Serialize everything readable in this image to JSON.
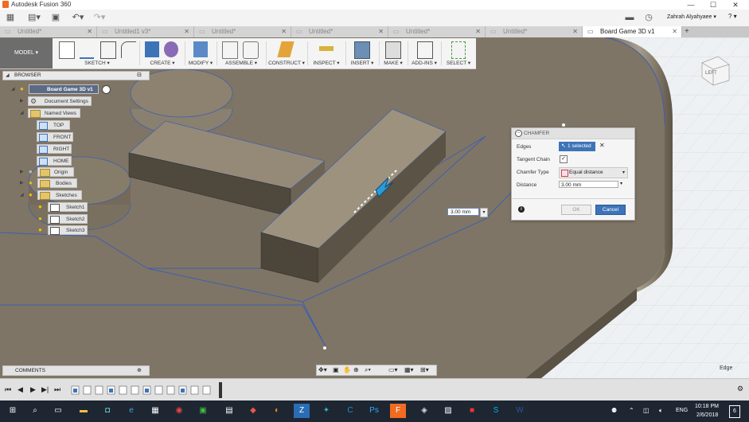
{
  "window": {
    "title": "Autodesk Fusion 360",
    "minimize": "—",
    "maximize": "☐",
    "close": "✕"
  },
  "appbar": {
    "user": "Zahrah Alyahyaee ▾",
    "help": "? ▾",
    "icons": [
      "apps-grid-icon",
      "file-icon",
      "save-icon",
      "undo-icon",
      "redo-icon",
      "chat-icon",
      "clock-icon"
    ]
  },
  "tabs": [
    {
      "label": "Untitled*",
      "active": false
    },
    {
      "label": "Untitled1 v3*",
      "active": false
    },
    {
      "label": "Untitled*",
      "active": false
    },
    {
      "label": "Untitled*",
      "active": false
    },
    {
      "label": "Untitled*",
      "active": false
    },
    {
      "label": "Untitled*",
      "active": false
    },
    {
      "label": "Board Game 3D v1",
      "active": true
    }
  ],
  "toolbar": {
    "mode": "MODEL ▾",
    "groups": [
      "SKETCH ▾",
      "CREATE ▾",
      "MODIFY ▾",
      "ASSEMBLE ▾",
      "CONSTRUCT ▾",
      "INSPECT ▾",
      "INSERT ▾",
      "MAKE ▾",
      "ADD-INS ▾",
      "SELECT ▾"
    ]
  },
  "browser": {
    "title": "BROWSER",
    "root": "Board Game 3D v1",
    "document_settings": "Document Settings",
    "named_views": "Named Views",
    "views": [
      "TOP",
      "FRONT",
      "RIGHT",
      "HOME"
    ],
    "origin": "Origin",
    "bodies": "Bodies",
    "sketches": "Sketches",
    "sketch_items": [
      "Sketch1",
      "Sketch2",
      "Sketch3"
    ]
  },
  "chamfer": {
    "title": "CHAMFER",
    "edges_label": "Edges",
    "edges_value": "1 selected",
    "tangent_label": "Tangent Chain",
    "tangent_checked": "✓",
    "type_label": "Chamfer Type",
    "type_value": "Equal distance",
    "distance_label": "Distance",
    "distance_value": "3.00 mm",
    "ok": "OK",
    "cancel": "Cancel"
  },
  "floating_input": "3.00 mm",
  "viewcube": {
    "face": "LEFT"
  },
  "comments": "COMMENTS",
  "edge_label": "Edge",
  "taskbar": {
    "language": "ENG",
    "time": "10:18 PM",
    "date": "2/6/2018",
    "notification_count": "6"
  },
  "colors": {
    "accent": "#3d74b8",
    "select_blue": "#2e6cc4",
    "model_surface": "#7f7566",
    "taskbar": "#1e2632"
  }
}
